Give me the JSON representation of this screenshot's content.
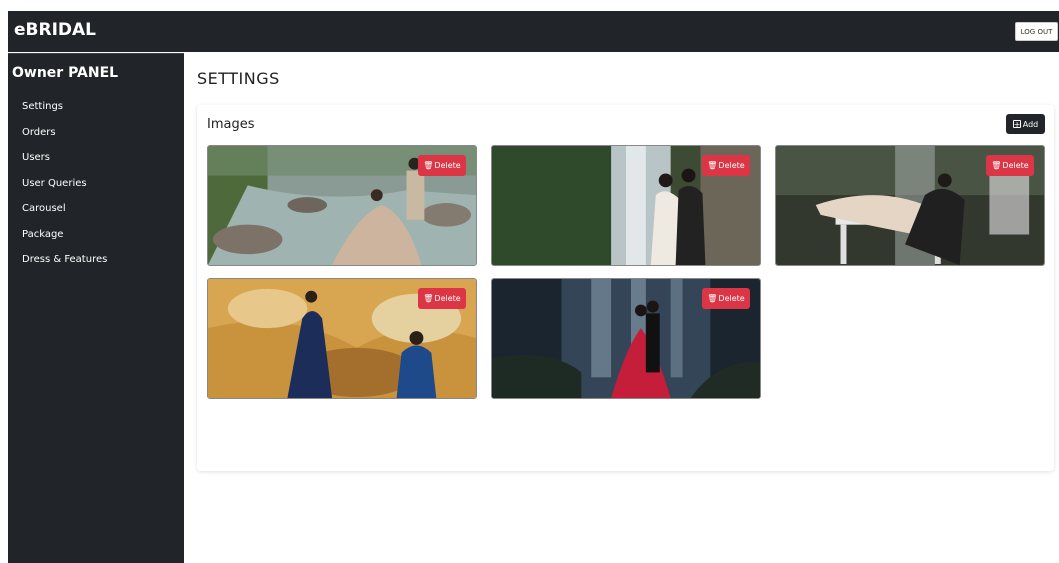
{
  "header": {
    "brand": "eBRIDAL",
    "logout_label": "LOG OUT"
  },
  "sidebar": {
    "title": "Owner PANEL",
    "items": [
      {
        "label": "Settings"
      },
      {
        "label": "Orders"
      },
      {
        "label": "Users"
      },
      {
        "label": "User Queries"
      },
      {
        "label": "Carousel"
      },
      {
        "label": "Package"
      },
      {
        "label": "Dress & Features"
      }
    ]
  },
  "main": {
    "page_title": "SETTINGS",
    "card_title": "Images",
    "add_label": "Add",
    "delete_label": "Delete",
    "images": [
      {
        "alt": "Couple on rocky river bank"
      },
      {
        "alt": "Couple in front of waterfall"
      },
      {
        "alt": "Couple on white bench in forest"
      },
      {
        "alt": "Couple on orange rock landscape"
      },
      {
        "alt": "Couple in red dress by dark waterfall"
      }
    ]
  },
  "colors": {
    "sidebar_bg": "#212529",
    "delete_bg": "#dc3545",
    "add_bg": "#212529"
  }
}
